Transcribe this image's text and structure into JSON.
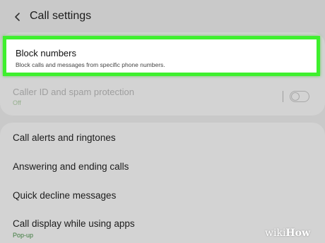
{
  "header": {
    "title": "Call settings"
  },
  "highlighted_item": {
    "title": "Block numbers",
    "subtitle": "Block calls and messages from specific phone numbers."
  },
  "caller_id": {
    "title": "Caller ID and spam protection",
    "status": "Off",
    "enabled": false
  },
  "items": [
    {
      "label": "Call alerts and ringtones"
    },
    {
      "label": "Answering and ending calls"
    },
    {
      "label": "Quick decline messages"
    },
    {
      "label": "Call display while using apps",
      "sub": "Pop-up"
    }
  ],
  "watermark": {
    "part1": "wiki",
    "part2": "How"
  },
  "colors": {
    "highlight_border": "#3ef02d",
    "status_green": "#3c7a3c",
    "background": "#c9c9c9"
  }
}
